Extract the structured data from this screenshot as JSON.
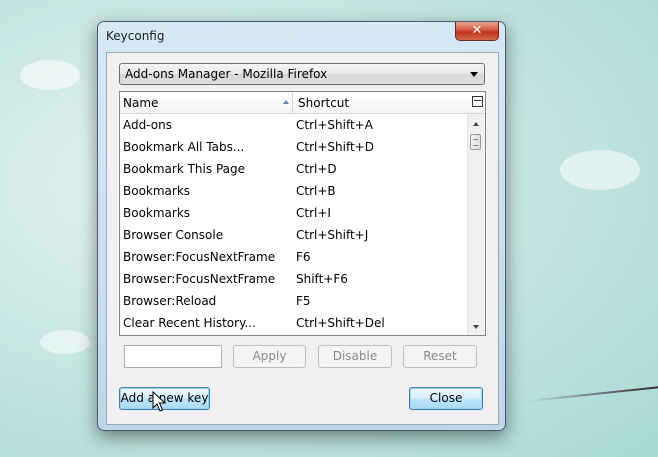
{
  "window": {
    "title": "Keyconfig",
    "close_glyph": "✕"
  },
  "combo": {
    "selected": "Add-ons Manager - Mozilla Firefox"
  },
  "list": {
    "columns": [
      "Name",
      "Shortcut"
    ],
    "rows": [
      {
        "name": "Add-ons",
        "shortcut": "Ctrl+Shift+A"
      },
      {
        "name": "Bookmark All Tabs...",
        "shortcut": "Ctrl+Shift+D"
      },
      {
        "name": "Bookmark This Page",
        "shortcut": "Ctrl+D"
      },
      {
        "name": "Bookmarks",
        "shortcut": "Ctrl+B"
      },
      {
        "name": "Bookmarks",
        "shortcut": "Ctrl+I"
      },
      {
        "name": "Browser Console",
        "shortcut": "Ctrl+Shift+J"
      },
      {
        "name": "Browser:FocusNextFrame",
        "shortcut": "F6"
      },
      {
        "name": "Browser:FocusNextFrame",
        "shortcut": "Shift+F6"
      },
      {
        "name": "Browser:Reload",
        "shortcut": "F5"
      },
      {
        "name": "Clear Recent History...",
        "shortcut": "Ctrl+Shift+Del"
      }
    ]
  },
  "editor": {
    "key_value": "",
    "apply_label": "Apply",
    "disable_label": "Disable",
    "reset_label": "Reset"
  },
  "footer": {
    "add_label": "Add a new key",
    "close_label": "Close"
  },
  "icons": {
    "column_picker": "column-picker-icon",
    "sort": "sort-ascending-icon",
    "cursor": "mouse-pointer-icon"
  }
}
